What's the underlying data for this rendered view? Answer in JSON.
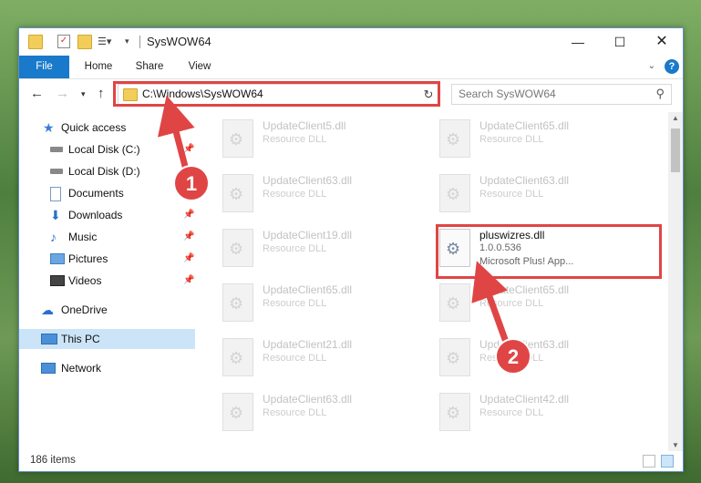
{
  "window": {
    "title": "SysWOW64"
  },
  "ribbon": {
    "tabs": [
      "File",
      "Home",
      "Share",
      "View"
    ],
    "help": "?"
  },
  "address": {
    "path": "C:\\Windows\\SysWOW64",
    "search_placeholder": "Search SysWOW64"
  },
  "sidebar": {
    "quick_access": "Quick access",
    "items": [
      "Local Disk (C:)",
      "Local Disk (D:)",
      "Documents",
      "Downloads",
      "Music",
      "Pictures",
      "Videos"
    ],
    "onedrive": "OneDrive",
    "this_pc": "This PC",
    "network": "Network"
  },
  "files": {
    "left": [
      {
        "name": "UpdateClient5.dll",
        "desc": "Resource DLL"
      },
      {
        "name": "UpdateClient63.dll",
        "desc": "Resource DLL"
      },
      {
        "name": "UpdateClient19.dll",
        "desc": "Resource DLL"
      },
      {
        "name": "UpdateClient65.dll",
        "desc": "Resource DLL"
      },
      {
        "name": "UpdateClient21.dll",
        "desc": "Resource DLL"
      },
      {
        "name": "UpdateClient63.dll",
        "desc": "Resource DLL"
      }
    ],
    "right": [
      {
        "name": "UpdateClient65.dll",
        "desc": "Resource DLL"
      },
      {
        "name": "UpdateClient63.dll",
        "desc": "Resource DLL"
      },
      {
        "name": "UpdateClient65.dll",
        "desc": "Resource DLL"
      },
      {
        "name": "UpdateClient63.dll",
        "desc": "Resource DLL"
      },
      {
        "name": "UpdateClient42.dll",
        "desc": "Resource DLL"
      }
    ],
    "highlighted": {
      "name": "pluswizres.dll",
      "version": "1.0.0.536",
      "desc": "Microsoft Plus! App..."
    }
  },
  "status": {
    "count": "186 items"
  },
  "annotations": {
    "step1": "1",
    "step2": "2",
    "color": "#e04545"
  }
}
